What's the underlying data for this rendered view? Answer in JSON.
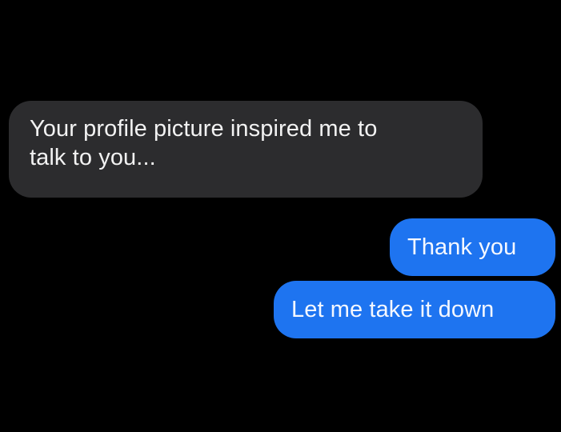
{
  "conversation": {
    "messages": [
      {
        "direction": "incoming",
        "text": "Your profile picture inspired me to\ntalk to you...",
        "color": "#2c2c2e"
      },
      {
        "direction": "outgoing",
        "text": "Thank you",
        "color": "#1e74f0"
      },
      {
        "direction": "outgoing",
        "text": "Let me take it down",
        "color": "#1e74f0"
      }
    ]
  },
  "theme": {
    "background": "#000000"
  }
}
